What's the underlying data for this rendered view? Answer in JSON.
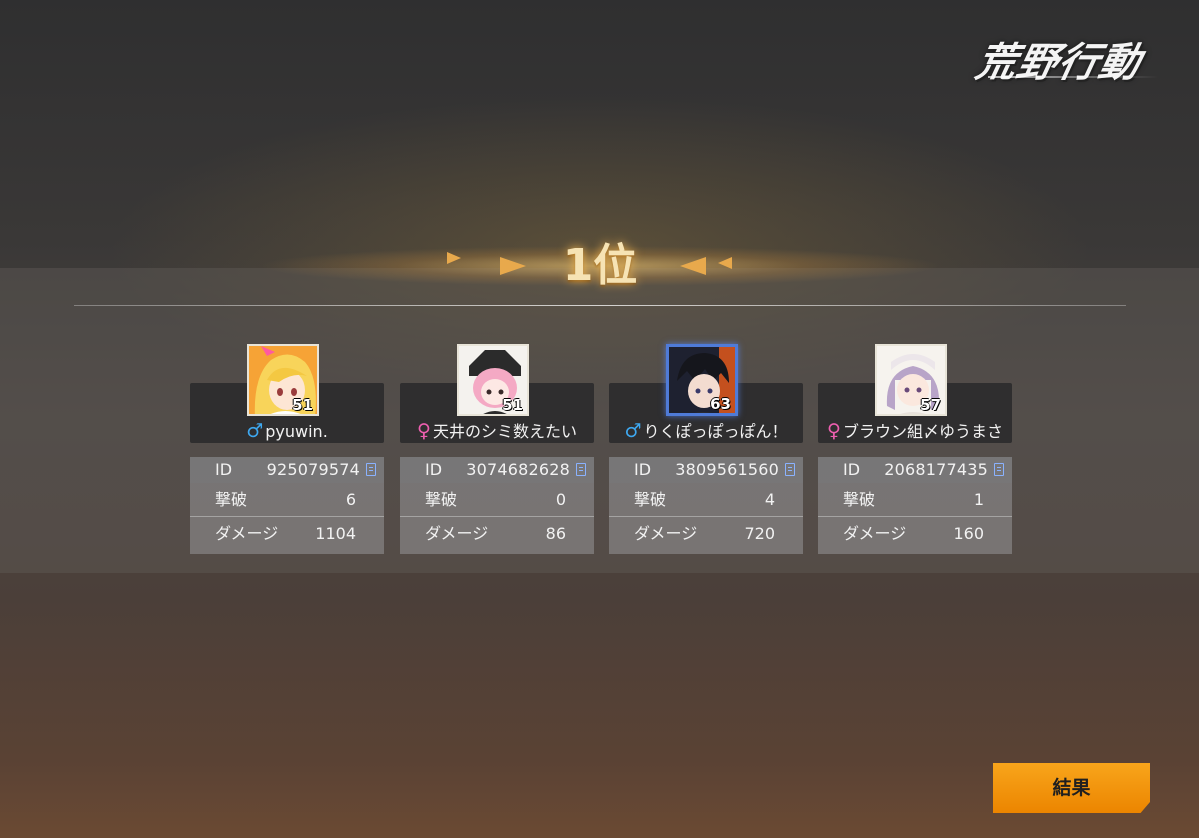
{
  "logo": {
    "text": "荒野行動"
  },
  "rank": {
    "label": "1位"
  },
  "players": [
    {
      "level": "51",
      "gender": "♂",
      "gender_type": "male",
      "name": "pyuwin.",
      "id_label": "ID",
      "id": "925079574",
      "kills_label": "撃破",
      "kills": "6",
      "damage_label": "ダメージ",
      "damage": "1104"
    },
    {
      "level": "51",
      "gender": "♀",
      "gender_type": "female",
      "name": "天井のシミ数えたい",
      "id_label": "ID",
      "id": "3074682628",
      "kills_label": "撃破",
      "kills": "0",
      "damage_label": "ダメージ",
      "damage": "86"
    },
    {
      "level": "63",
      "gender": "♂",
      "gender_type": "male",
      "name": "りくぽっぽっぽん！",
      "id_label": "ID",
      "id": "3809561560",
      "kills_label": "撃破",
      "kills": "4",
      "damage_label": "ダメージ",
      "damage": "720"
    },
    {
      "level": "57",
      "gender": "♀",
      "gender_type": "female",
      "name": "ブラウン組〆ゆうまさ",
      "id_label": "ID",
      "id": "2068177435",
      "kills_label": "撃破",
      "kills": "1",
      "damage_label": "ダメージ",
      "damage": "160"
    }
  ],
  "buttons": {
    "result_label": "結果"
  },
  "colors": {
    "accent_orange": "#f29a0f",
    "male": "#3ea8f0",
    "female": "#ee5fb0",
    "rank_gold": "#f6e3b4"
  }
}
